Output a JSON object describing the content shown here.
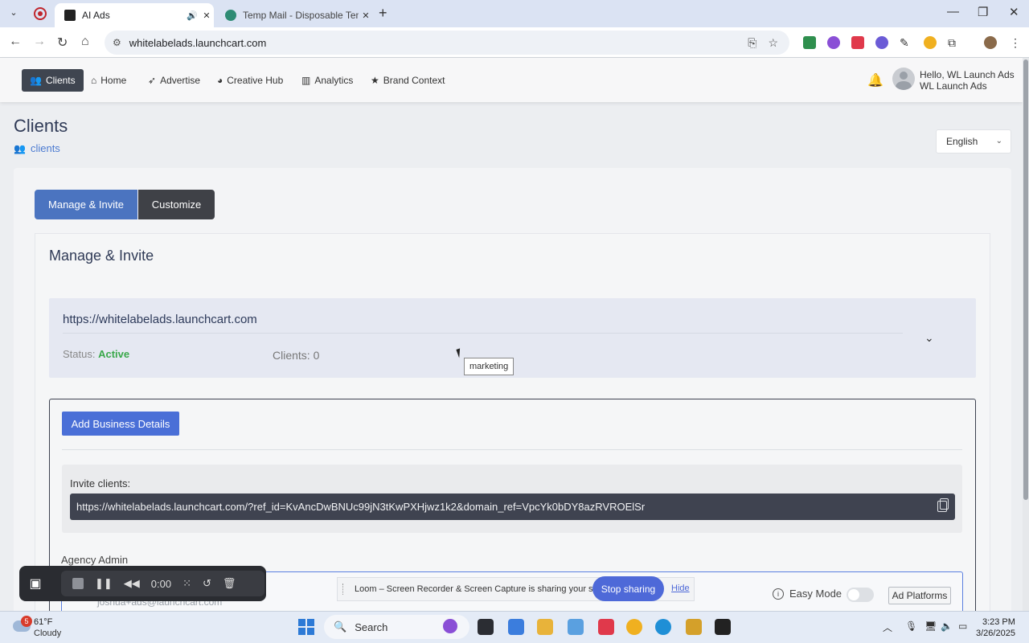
{
  "browser": {
    "tabs": [
      {
        "title": "AI Ads",
        "active": true
      },
      {
        "title": "Temp Mail - Disposable Tempo",
        "active": false
      }
    ],
    "url": "whitelabelads.launchcart.com"
  },
  "nav": {
    "items": [
      {
        "label": "Clients",
        "icon": "users-icon",
        "active": true
      },
      {
        "label": "Home",
        "icon": "home-icon"
      },
      {
        "label": "Advertise",
        "icon": "rocket-icon"
      },
      {
        "label": "Creative Hub",
        "icon": "palette-icon"
      },
      {
        "label": "Analytics",
        "icon": "chart-icon"
      },
      {
        "label": "Brand Context",
        "icon": "star-icon"
      }
    ],
    "greeting_line1": "Hello, WL Launch Ads",
    "greeting_line2": "WL Launch Ads"
  },
  "page": {
    "title": "Clients",
    "breadcrumb": "clients",
    "language": "English"
  },
  "tabs": {
    "manage": "Manage & Invite",
    "customize": "Customize"
  },
  "section": {
    "title": "Manage & Invite",
    "domain": "https://whitelabelads.launchcart.com",
    "status_label": "Status:",
    "status_value": "Active",
    "clients_count": "Clients: 0",
    "tooltip": "marketing",
    "add_business": "Add Business Details",
    "invite_label": "Invite clients:",
    "invite_url": "https://whitelabelads.launchcart.com/?ref_id=KvAncDwBNUc99jN3tKwPXHjwz1k2&domain_ref=VpcYk0bDY8azRVROElSr",
    "agency_admin": "Agency Admin",
    "agency_email": "joshua+ads@launchcart.com"
  },
  "loom": {
    "time": "0:00",
    "share_message": "Loom – Screen Recorder & Screen Capture is sharing your screen.",
    "stop_sharing": "Stop sharing",
    "hide": "Hide"
  },
  "footer_controls": {
    "easy_mode": "Easy Mode",
    "ad_platforms": "Ad Platforms"
  },
  "taskbar": {
    "weather_temp": "61°F",
    "weather_cond": "Cloudy",
    "weather_badge": "5",
    "search": "Search",
    "time": "3:23 PM",
    "date": "3/26/2025"
  }
}
